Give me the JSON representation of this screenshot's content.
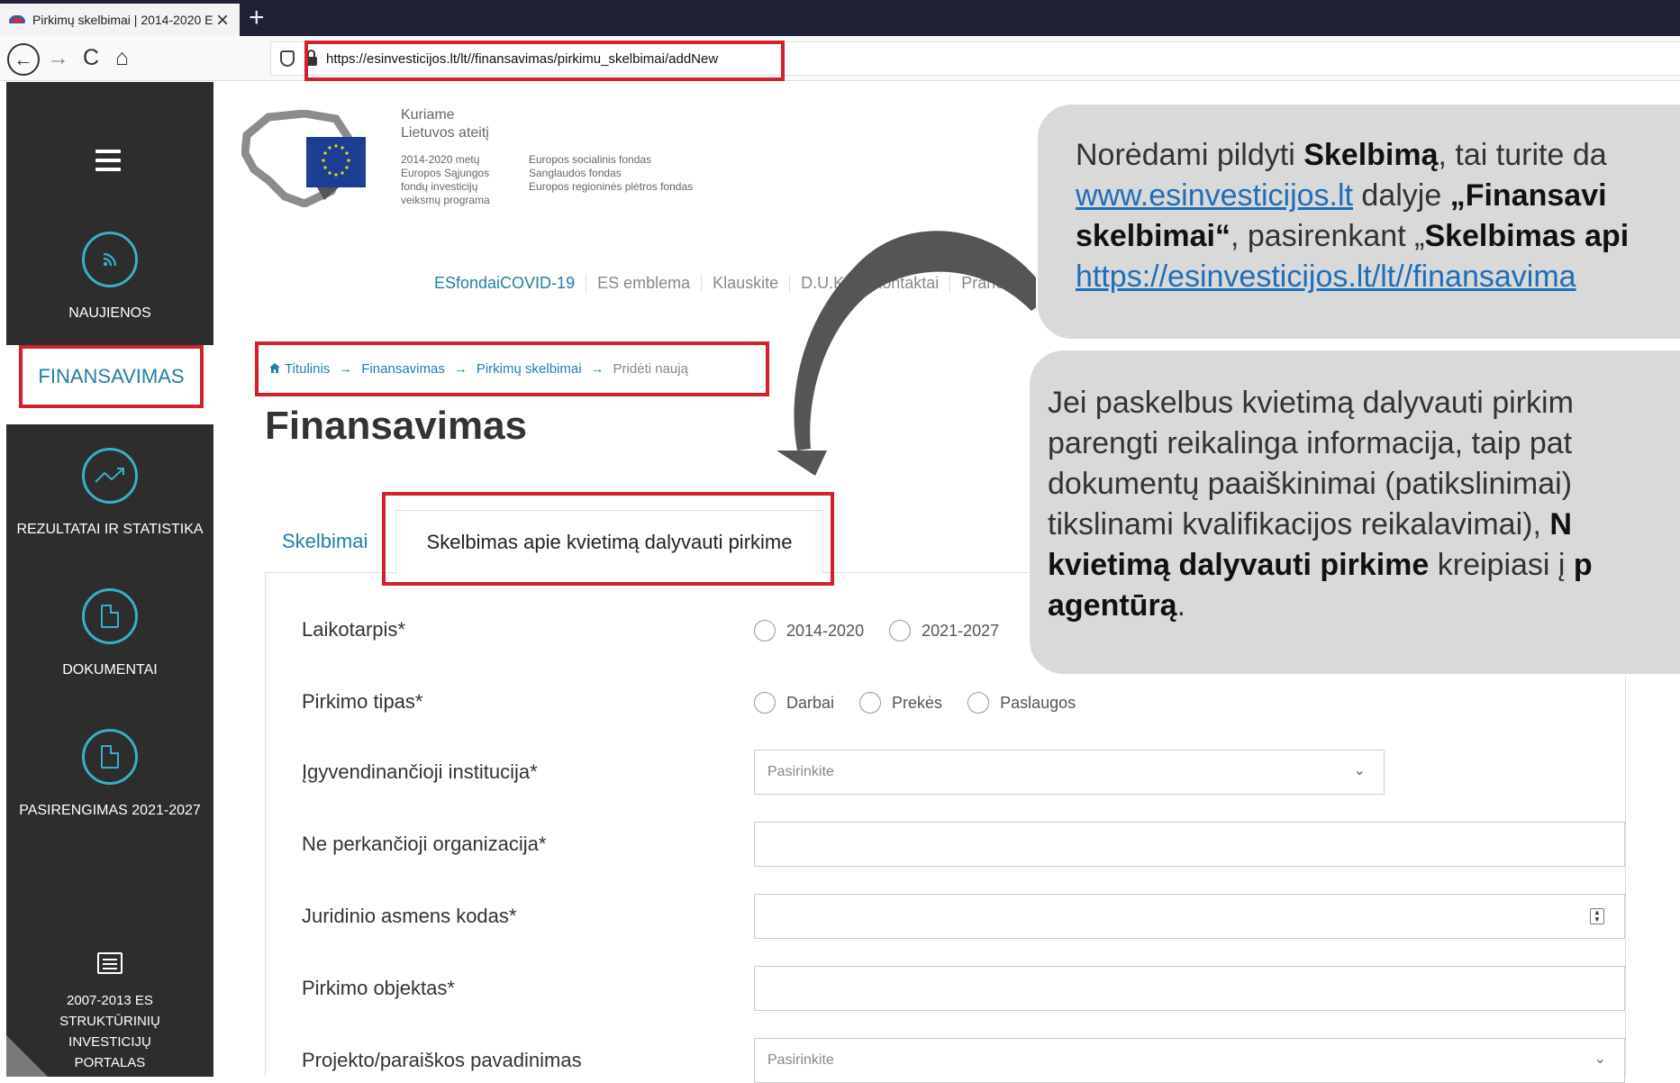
{
  "browser": {
    "tab_title": "Pirkimų skelbimai | 2014-2020 E",
    "tab_close": "×",
    "new_tab": "+",
    "url": "https://esinvesticijos.lt/lt//finansavimas/pirkimu_skelbimai/addNew",
    "back": "←",
    "forward": "→",
    "reload": "C",
    "home": "⌂"
  },
  "sidebar": {
    "items": [
      {
        "label": "NAUJIENOS",
        "icon": "rss-icon"
      },
      {
        "label": "FINANSAVIMAS",
        "active": true
      },
      {
        "label": "REZULTATAI IR STATISTIKA",
        "icon": "chart-icon"
      },
      {
        "label": "DOKUMENTAI",
        "icon": "document-icon"
      },
      {
        "label": "PASIRENGIMAS 2021-2027",
        "icon": "document-icon"
      }
    ],
    "legacy_lines": [
      "2007-2013 ES",
      "STRUKTŪRINIŲ",
      "INVESTICIJŲ",
      "PORTALAS"
    ]
  },
  "header": {
    "logo_lines": [
      "Kuriame",
      "Lietuvos ateitį"
    ],
    "logo_small_left": [
      "2014-2020 metų",
      "Europos Sąjungos",
      "fondų investicijų",
      "veiksmų programa"
    ],
    "logo_small_right": [
      "Europos socialinis fondas",
      "Sanglaudos fondas",
      "Europos regioninės plėtros fondas"
    ],
    "top_links": [
      "ESfondaiCOVID-19",
      "ES emblema",
      "Klauskite",
      "D.U.K.",
      "Kontaktai",
      "Pranešk"
    ]
  },
  "breadcrumb": {
    "home": "Titulinis",
    "items": [
      "Finansavimas",
      "Pirkimų skelbimai",
      "Pridėti naują"
    ],
    "separator": "→"
  },
  "main": {
    "title": "Finansavimas",
    "tab_inactive": "Skelbimai",
    "tab_active": "Skelbimas apie kvietimą dalyvauti pirkime"
  },
  "form": {
    "laikotarpis": {
      "label": "Laikotarpis*",
      "options": [
        "2014-2020",
        "2021-2027"
      ]
    },
    "pirkimo_tipas": {
      "label": "Pirkimo tipas*",
      "options": [
        "Darbai",
        "Prekės",
        "Paslaugos"
      ]
    },
    "institucija": {
      "label": "Įgyvendinančioji institucija*",
      "placeholder": "Pasirinkite"
    },
    "organizacija": {
      "label": "Ne perkančioji organizacija*",
      "value": ""
    },
    "kodas": {
      "label": "Juridinio asmens kodas*",
      "value": ""
    },
    "objektas": {
      "label": "Pirkimo objektas*",
      "value": ""
    },
    "projektas": {
      "label": "Projekto/paraiškos pavadinimas",
      "placeholder": "Pasirinkite"
    }
  },
  "callout1": {
    "l1a": "Norėdami pildyti ",
    "l1b": "Skelbimą",
    "l1c": ", tai turite da",
    "l2a": "www.esinvesticijos.lt",
    "l2b": " dalyje ",
    "l2c": "„Finansavi",
    "l3a": "skelbimai“",
    "l3b": ", pasirenkant „",
    "l3c": "Skelbimas api",
    "l4": "https://esinvesticijos.lt/lt//finansavima"
  },
  "callout2": {
    "l1": "Jei paskelbus kvietimą dalyvauti pirkim",
    "l2": "parengti reikalinga informacija, taip pat",
    "l3": "dokumentų paaiškinimai (patikslinimai)",
    "l4a": "tikslinami kvalifikacijos reikalavimai), ",
    "l4b": "N",
    "l5a": "kvietimą dalyvauti pirkime",
    "l5b": " kreipiasi į ",
    "l5c": "p",
    "l6a": "agentūrą",
    "l6b": "."
  },
  "colors": {
    "highlight": "#d3202e",
    "accent": "#1f7fa8",
    "sidebar_bg": "#2d2d2d",
    "icon_ring": "#3aaec8",
    "callout_bg": "#d9d9d9"
  }
}
